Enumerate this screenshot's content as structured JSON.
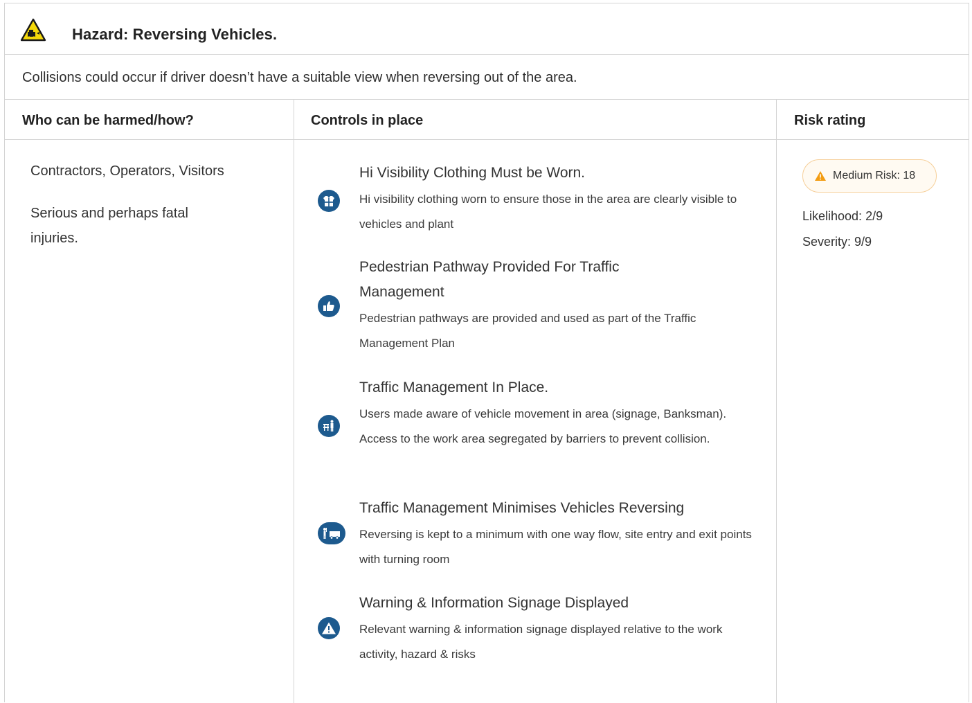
{
  "hazard": {
    "icon": "reversing-vehicle-warning-icon",
    "title": "Hazard:  Reversing Vehicles.",
    "description": "Collisions could occur if driver doesn’t have a suitable view when reversing out of the area."
  },
  "columns": {
    "who": "Who can be harmed/how?",
    "controls": "Controls in place",
    "risk": "Risk rating"
  },
  "who": {
    "people": "Contractors, Operators, Visitors",
    "harm": "Serious and perhaps fatal injuries."
  },
  "controls": [
    {
      "icon": "hi-vis-vest-icon",
      "title": "Hi Visibility Clothing Must be Worn.",
      "text": "Hi visibility clothing worn to ensure those in the area are clearly visible to vehicles and plant"
    },
    {
      "icon": "thumbs-up-icon",
      "title": "Pedestrian Pathway Provided For Traffic Management",
      "text": "Pedestrian pathways are provided and used as part of the Traffic Management Plan"
    },
    {
      "icon": "barrier-person-icon",
      "title": "Traffic Management In Place.",
      "text": "Users made aware of vehicle movement in area (signage, Banksman). Access to the work area segregated by barriers to prevent collision."
    },
    {
      "icon": "banksman-truck-icon",
      "title": "Traffic Management Minimises Vehicles Reversing",
      "text": "Reversing is kept to a minimum with one way flow, site entry and exit points with turning room"
    },
    {
      "icon": "warning-triangle-icon",
      "title": "Warning & Information Signage Displayed",
      "text": "Relevant warning & information signage displayed relative to the work activity, hazard & risks"
    }
  ],
  "risk": {
    "badge": "Medium Risk: 18",
    "badge_color": "#f39c12",
    "likelihood": "Likelihood: 2/9",
    "severity": "Severity: 9/9"
  },
  "colors": {
    "icon_blue": "#1d5a8e",
    "border": "#d4d4d4",
    "hazard_yellow": "#f5d90a"
  }
}
